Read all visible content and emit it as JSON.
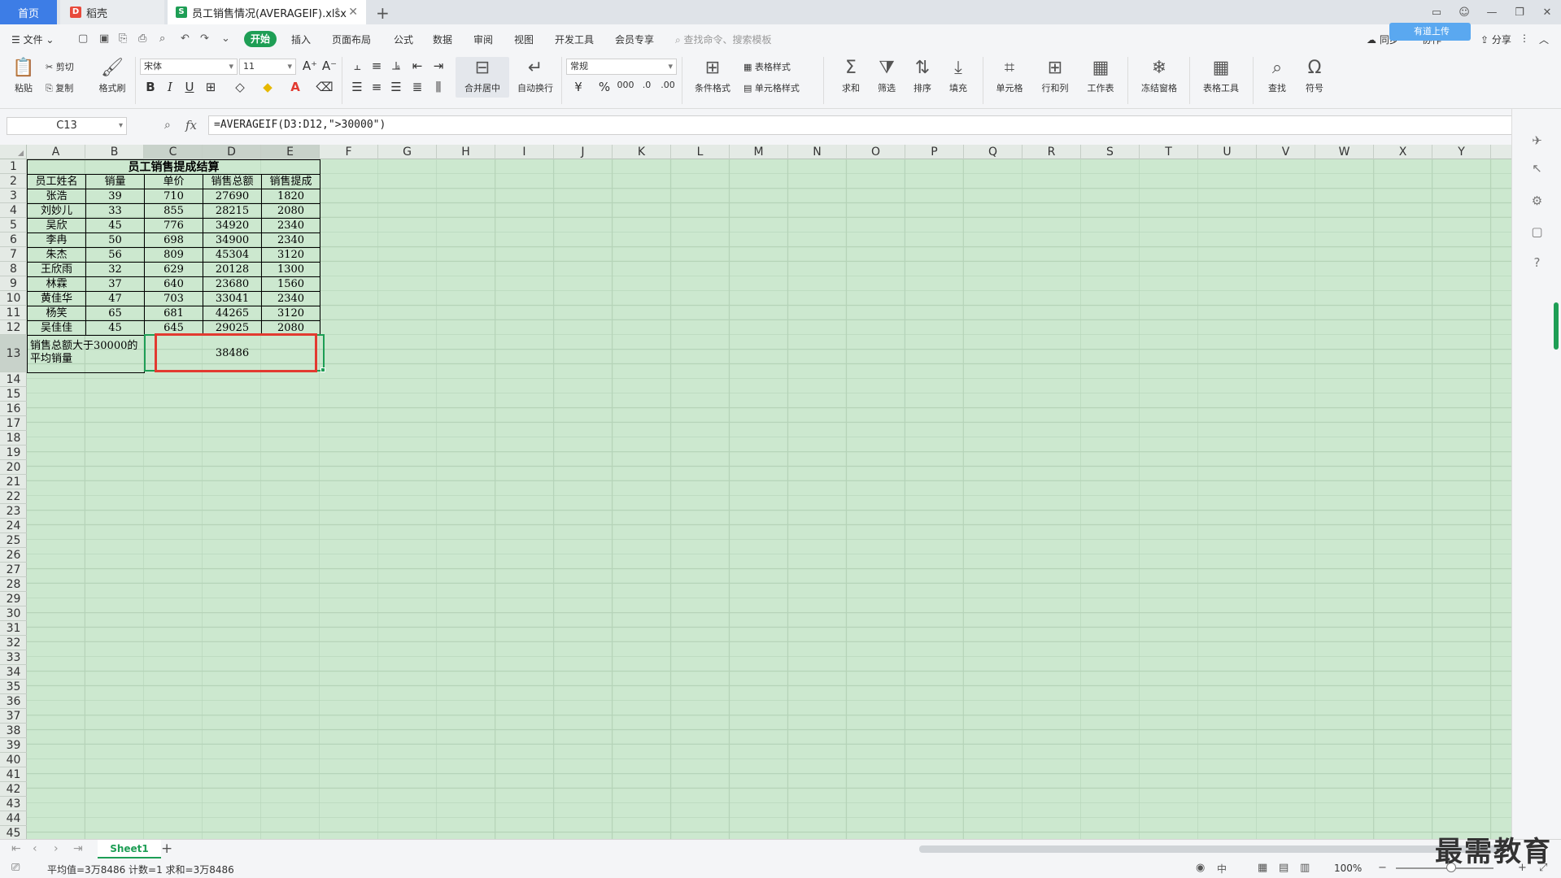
{
  "tabs": {
    "home": "首页",
    "daoke": "稻壳",
    "doc": "员工销售情况(AVERAGEIF).xlsx"
  },
  "menu": {
    "file": "文件",
    "start": "开始",
    "items": [
      "插入",
      "页面布局",
      "公式",
      "数据",
      "审阅",
      "视图",
      "开发工具",
      "会员专享"
    ],
    "search_placeholder": "查找命令、搜索模板",
    "cloud": "有道上传",
    "sync": "同步",
    "collab": "协作",
    "share": "分享"
  },
  "ribbon": {
    "paste": "粘贴",
    "cut": "剪切",
    "copy": "复制",
    "format_painter": "格式刷",
    "font_name": "宋体",
    "font_size": "11",
    "merge_center": "合并居中",
    "wrap_text": "自动换行",
    "number_format": "常规",
    "conditional_format": "条件格式",
    "table_style": "表格样式",
    "cell_style": "单元格样式",
    "sum": "求和",
    "filter": "筛选",
    "sort": "排序",
    "fill": "填充",
    "cells": "单元格",
    "rows_cols": "行和列",
    "worksheet": "工作表",
    "freeze": "冻结窗格",
    "table_tools": "表格工具",
    "find": "查找",
    "symbol": "符号"
  },
  "formula_bar": {
    "cell_ref": "C13",
    "fx": "fx",
    "formula": "=AVERAGEIF(D3:D12,\">30000\")"
  },
  "columns": [
    "A",
    "B",
    "C",
    "D",
    "E",
    "F",
    "G",
    "H",
    "I",
    "J",
    "K",
    "L",
    "M",
    "N",
    "O",
    "P",
    "Q",
    "R",
    "S",
    "T",
    "U",
    "V",
    "W",
    "X",
    "Y"
  ],
  "rows": [
    "1",
    "2",
    "3",
    "4",
    "5",
    "6",
    "7",
    "8",
    "9",
    "10",
    "11",
    "12",
    "13",
    "14",
    "15",
    "16",
    "17",
    "18",
    "19",
    "20",
    "21",
    "22",
    "23",
    "24",
    "25",
    "26",
    "27",
    "28",
    "29",
    "30",
    "31",
    "32",
    "33",
    "34",
    "35",
    "36",
    "37",
    "38",
    "39",
    "40",
    "41",
    "42",
    "43",
    "44",
    "45"
  ],
  "sheet": {
    "title": "员工销售提成结算",
    "headers": [
      "员工姓名",
      "销量",
      "单价",
      "销售总额",
      "销售提成"
    ],
    "data": [
      [
        "张浩",
        "39",
        "710",
        "27690",
        "1820"
      ],
      [
        "刘妙儿",
        "33",
        "855",
        "28215",
        "2080"
      ],
      [
        "吴欣",
        "45",
        "776",
        "34920",
        "2340"
      ],
      [
        "李冉",
        "50",
        "698",
        "34900",
        "2340"
      ],
      [
        "朱杰",
        "56",
        "809",
        "45304",
        "3120"
      ],
      [
        "王欣雨",
        "32",
        "629",
        "20128",
        "1300"
      ],
      [
        "林霖",
        "37",
        "640",
        "23680",
        "1560"
      ],
      [
        "黄佳华",
        "47",
        "703",
        "33041",
        "2340"
      ],
      [
        "杨笑",
        "65",
        "681",
        "44265",
        "3120"
      ],
      [
        "吴佳佳",
        "45",
        "645",
        "29025",
        "2080"
      ]
    ],
    "summary_label": "销售总额大于30000的平均销量",
    "summary_value": "38486"
  },
  "sheet_tab": "Sheet1",
  "status": {
    "text": "平均值=3万8486  计数=1  求和=3万8486",
    "zoom": "100%",
    "input_mode": "中"
  },
  "watermark": "最需教育",
  "colors": {
    "accent": "#1e9e55",
    "grid_bg": "#cce8cf",
    "highlight": "#e23a30"
  }
}
